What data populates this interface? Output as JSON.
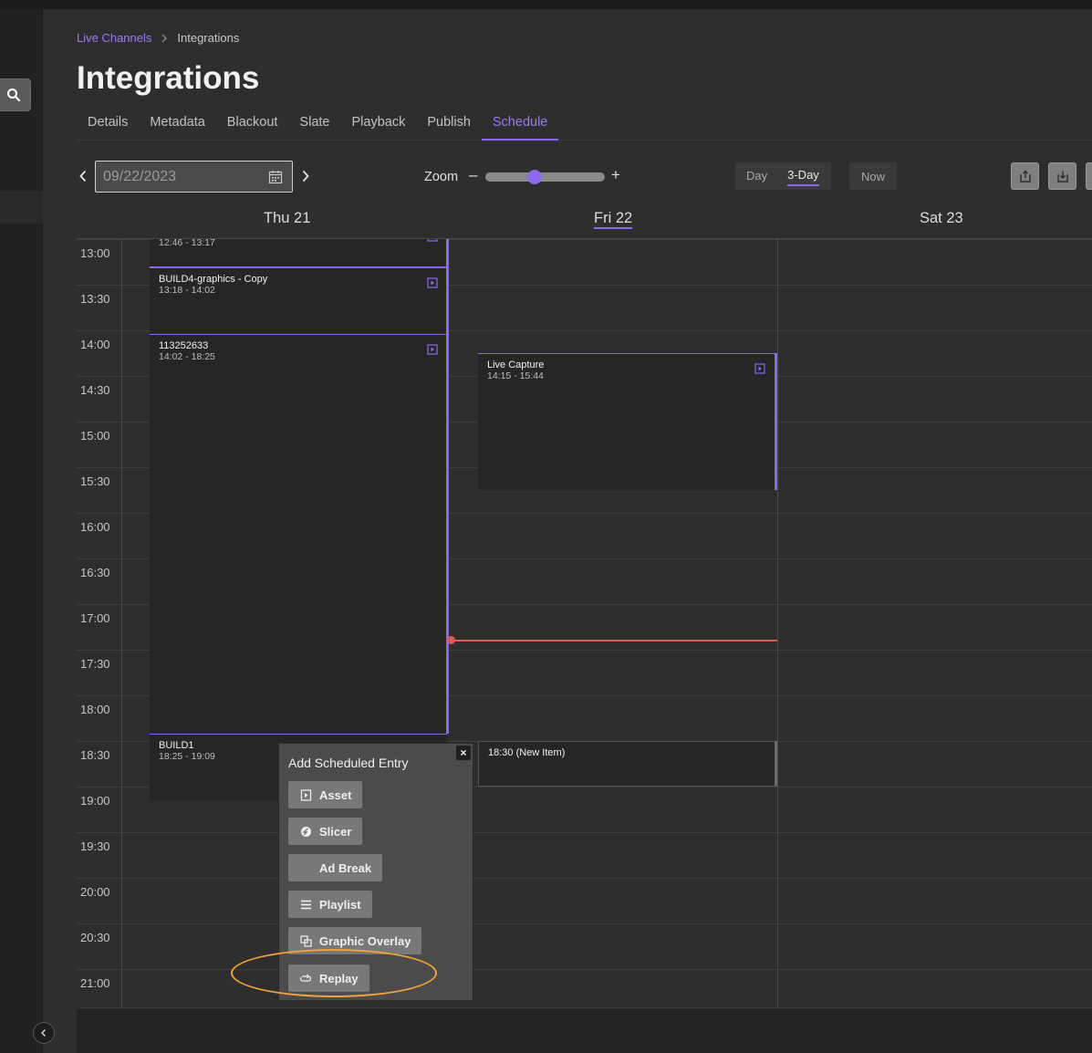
{
  "breadcrumb": {
    "parent": "Live Channels",
    "current": "Integrations"
  },
  "page_title": "Integrations",
  "tabs": [
    "Details",
    "Metadata",
    "Blackout",
    "Slate",
    "Playback",
    "Publish",
    "Schedule"
  ],
  "active_tab": "Schedule",
  "toolbar": {
    "date_value": "09/22/2023",
    "zoom_label": "Zoom",
    "zoom_minus": "–",
    "zoom_plus": "+",
    "view_day": "Day",
    "view_3day": "3-Day",
    "now_label": "Now"
  },
  "days": [
    "Thu 21",
    "Fri 22",
    "Sat 23"
  ],
  "today": "Fri 22",
  "time_labels": [
    "13:00",
    "13:30",
    "14:00",
    "14:30",
    "15:00",
    "15:30",
    "16:00",
    "16:30",
    "17:00",
    "17:30",
    "18:00",
    "18:30",
    "19:00",
    "19:30",
    "20:00",
    "20:30",
    "21:00"
  ],
  "events": {
    "ev0": {
      "title": "",
      "time": "12:46 - 13:17"
    },
    "ev1": {
      "title": "BUILD4-graphics - Copy",
      "time": "13:18 - 14:02"
    },
    "ev2": {
      "title": "113252633",
      "time": "14:02 - 18:25"
    },
    "ev3": {
      "title": "BUILD1",
      "time": "18:25 - 19:09"
    },
    "ev4": {
      "title": "Live Capture",
      "time": "14:15 - 15:44"
    },
    "ev5": {
      "title": "18:30 (New Item)",
      "time": ""
    }
  },
  "popup": {
    "title": "Add Scheduled Entry",
    "close": "×",
    "asset": "Asset",
    "slicer": "Slicer",
    "ad_break": "Ad Break",
    "playlist": "Playlist",
    "graphic_overlay": "Graphic Overlay",
    "replay": "Replay"
  },
  "colors": {
    "accent": "#8b68ee",
    "now_line": "#e05a5a",
    "highlight": "#f0a23c"
  }
}
